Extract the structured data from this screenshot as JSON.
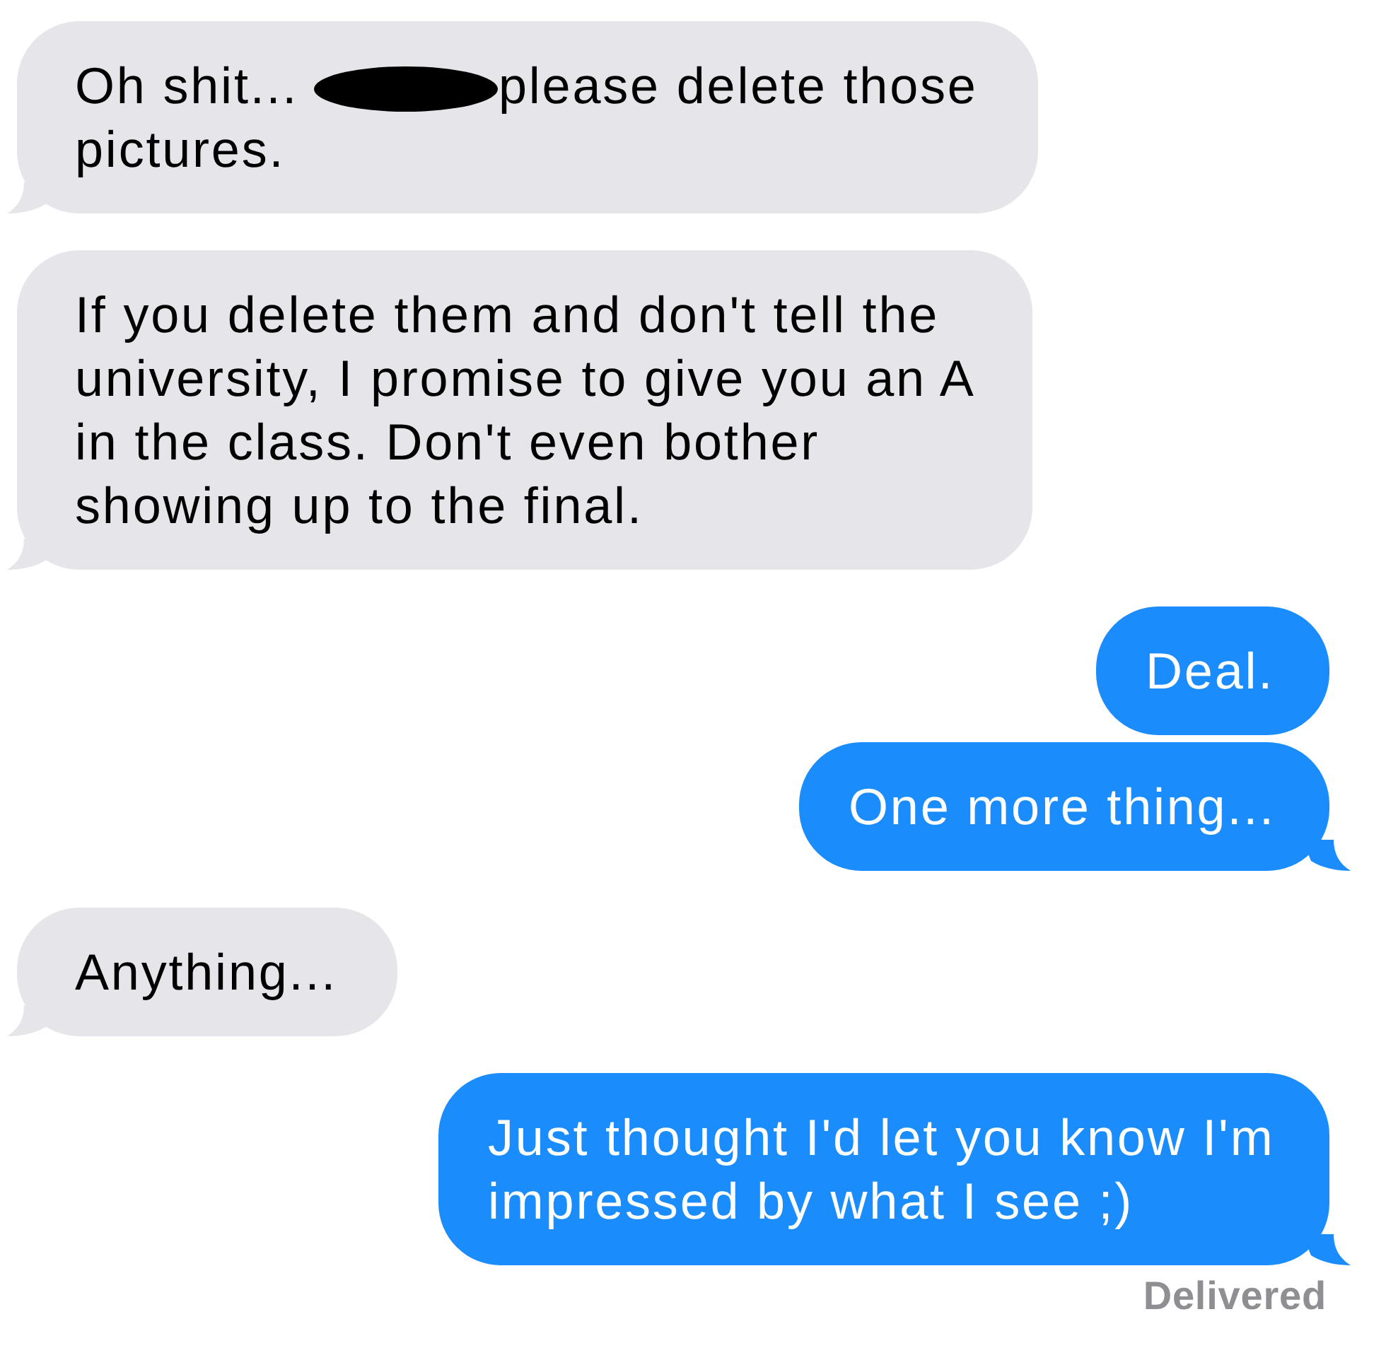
{
  "messages": [
    {
      "kind": "received",
      "tail": true,
      "text": "Oh shit...",
      "redaction": true,
      "text_after_redaction": "please delete those pictures."
    },
    {
      "kind": "received",
      "tail": true,
      "text": "If you delete them and don't tell the university, I promise to give you an A in the class. Don't even bother showing up to the final."
    },
    {
      "kind": "sent",
      "tail": false,
      "text": "Deal."
    },
    {
      "kind": "sent",
      "tail": true,
      "text": "One more thing..."
    },
    {
      "kind": "received",
      "tail": true,
      "text": "Anything..."
    },
    {
      "kind": "sent",
      "tail": true,
      "text": "Just thought I'd let you know I'm impressed by what I see ;)"
    }
  ],
  "delivery_status": "Delivered"
}
